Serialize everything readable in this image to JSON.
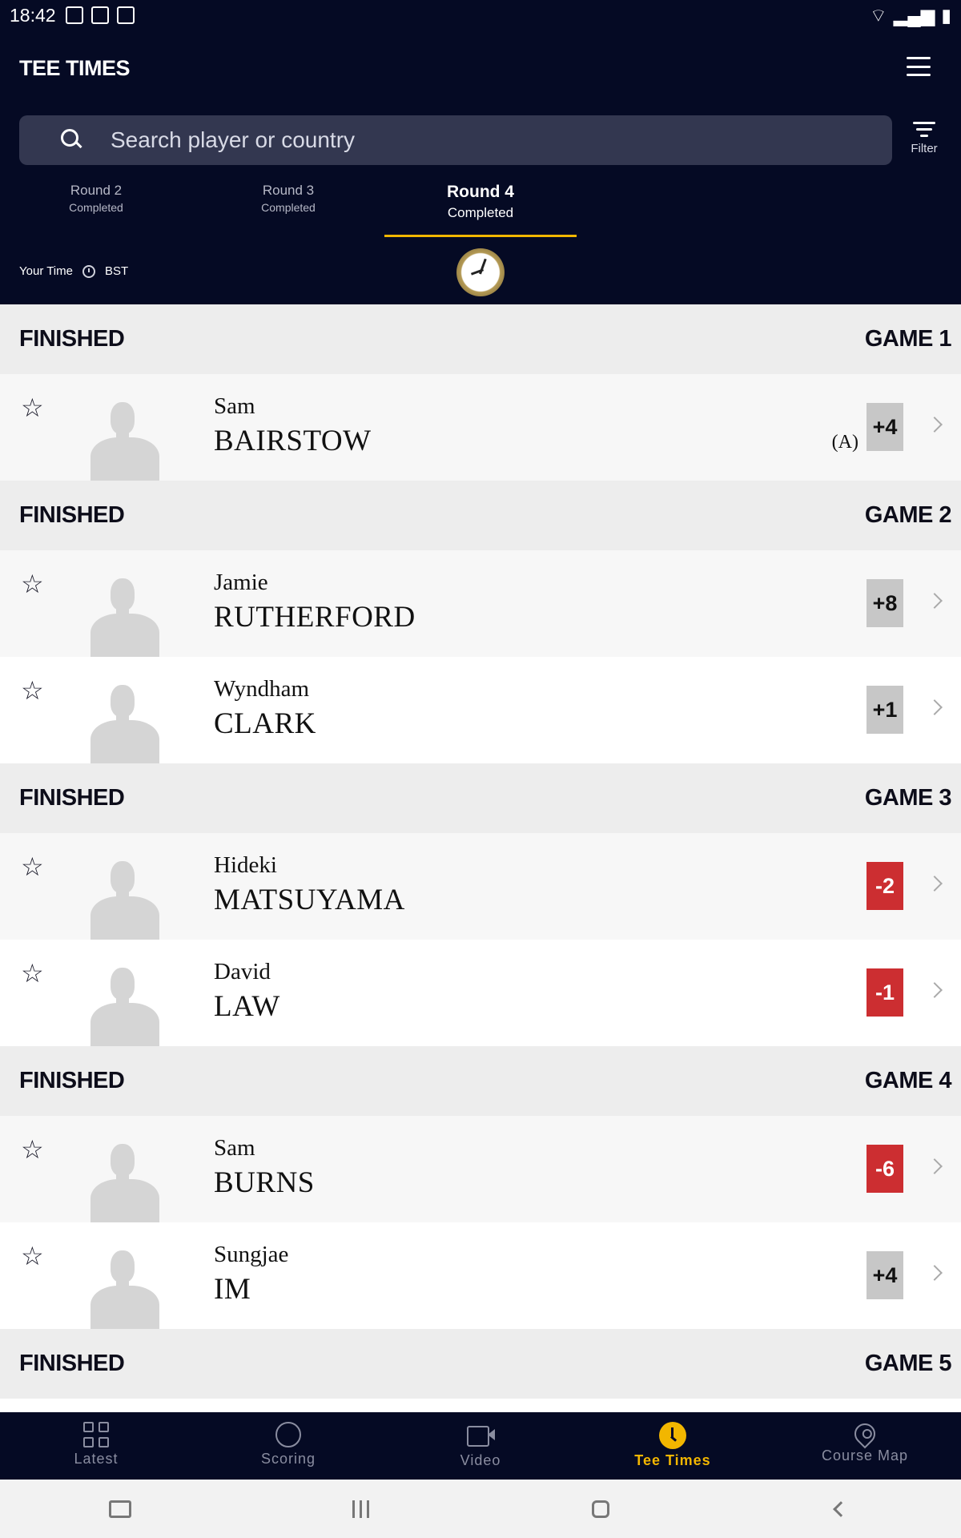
{
  "status_bar": {
    "time": "18:42"
  },
  "header": {
    "title": "TEE TIMES",
    "search_placeholder": "Search player or country",
    "filter_label": "Filter",
    "your_time_label": "Your Time",
    "timezone": "BST"
  },
  "rounds": [
    {
      "name": "Round 2",
      "status": "Completed"
    },
    {
      "name": "Round 3",
      "status": "Completed"
    },
    {
      "name": "Round 4",
      "status": "Completed",
      "active": true
    }
  ],
  "groups": [
    {
      "status": "FINISHED",
      "game": "GAME 1",
      "players": [
        {
          "first": "Sam",
          "last": "BAIRSTOW",
          "amateur": "(A)",
          "score": "+4",
          "under": false
        }
      ]
    },
    {
      "status": "FINISHED",
      "game": "GAME 2",
      "players": [
        {
          "first": "Jamie",
          "last": "RUTHERFORD",
          "score": "+8",
          "under": false
        },
        {
          "first": "Wyndham",
          "last": "CLARK",
          "score": "+1",
          "under": false
        }
      ]
    },
    {
      "status": "FINISHED",
      "game": "GAME 3",
      "players": [
        {
          "first": "Hideki",
          "last": "MATSUYAMA",
          "score": "-2",
          "under": true
        },
        {
          "first": "David",
          "last": "LAW",
          "score": "-1",
          "under": true
        }
      ]
    },
    {
      "status": "FINISHED",
      "game": "GAME 4",
      "players": [
        {
          "first": "Sam",
          "last": "BURNS",
          "score": "-6",
          "under": true
        },
        {
          "first": "Sungjae",
          "last": "IM",
          "score": "+4",
          "under": false
        }
      ]
    },
    {
      "status": "FINISHED",
      "game": "GAME 5",
      "players": []
    }
  ],
  "bottom_nav": [
    {
      "label": "Latest",
      "icon": "grid-icon"
    },
    {
      "label": "Scoring",
      "icon": "golf-ball-icon"
    },
    {
      "label": "Video",
      "icon": "video-icon"
    },
    {
      "label": "Tee Times",
      "icon": "clock-icon",
      "active": true
    },
    {
      "label": "Course Map",
      "icon": "map-pin-icon"
    }
  ],
  "colors": {
    "header_bg": "#050a24",
    "accent": "#f2b600",
    "under_par": "#cc2e31",
    "over_par": "#c7c7c7"
  }
}
